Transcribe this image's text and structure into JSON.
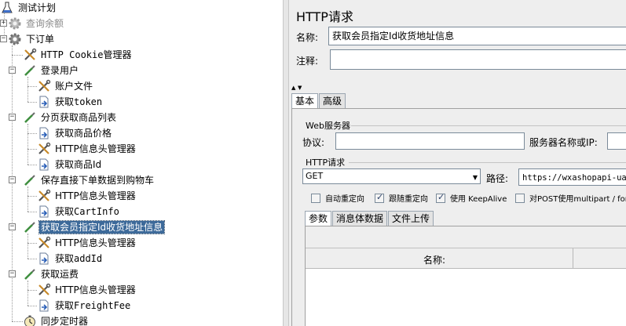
{
  "tree": {
    "root": "测试计划",
    "items": [
      {
        "label": "查询余额",
        "state": "disabled"
      },
      {
        "label": "下订单"
      },
      {
        "label": "HTTP Cookie管理器"
      },
      {
        "label": "登录用户"
      },
      {
        "label": "账户文件"
      },
      {
        "label": "获取token"
      },
      {
        "label": "分页获取商品列表"
      },
      {
        "label": "获取商品价格"
      },
      {
        "label": "HTTP信息头管理器"
      },
      {
        "label": "获取商品Id"
      },
      {
        "label": "保存直接下单数据到购物车"
      },
      {
        "label": "HTTP信息头管理器"
      },
      {
        "label": "获取CartInfo"
      },
      {
        "label": "获取会员指定Id收货地址信息",
        "state": "selected"
      },
      {
        "label": "HTTP信息头管理器"
      },
      {
        "label": "获取addId"
      },
      {
        "label": "获取运费"
      },
      {
        "label": "HTTP信息头管理器"
      },
      {
        "label": "获取FreightFee"
      },
      {
        "label": "同步定时器"
      }
    ]
  },
  "panel": {
    "title": "HTTP请求",
    "name_label": "名称:",
    "name_value": "获取会员指定Id收货地址信息",
    "comment_label": "注释:",
    "comment_value": "",
    "tabs": [
      "基本",
      "高级"
    ],
    "web_server": {
      "title": "Web服务器",
      "protocol_label": "协议:",
      "protocol_value": "",
      "server_label": "服务器名称或IP:",
      "server_value": ""
    },
    "http_request": {
      "title": "HTTP请求",
      "method": "GET",
      "path_label": "路径:",
      "path_value": "https://wxashopapi-uat."
    },
    "checkboxes": [
      {
        "label": "自动重定向",
        "checked": false
      },
      {
        "label": "跟随重定向",
        "checked": true
      },
      {
        "label": "使用 KeepAlive",
        "checked": true
      },
      {
        "label": "对POST使用multipart / for",
        "checked": false
      }
    ],
    "param_tabs": [
      "参数",
      "消息体数据",
      "文件上传"
    ],
    "table_header": "名称:"
  }
}
